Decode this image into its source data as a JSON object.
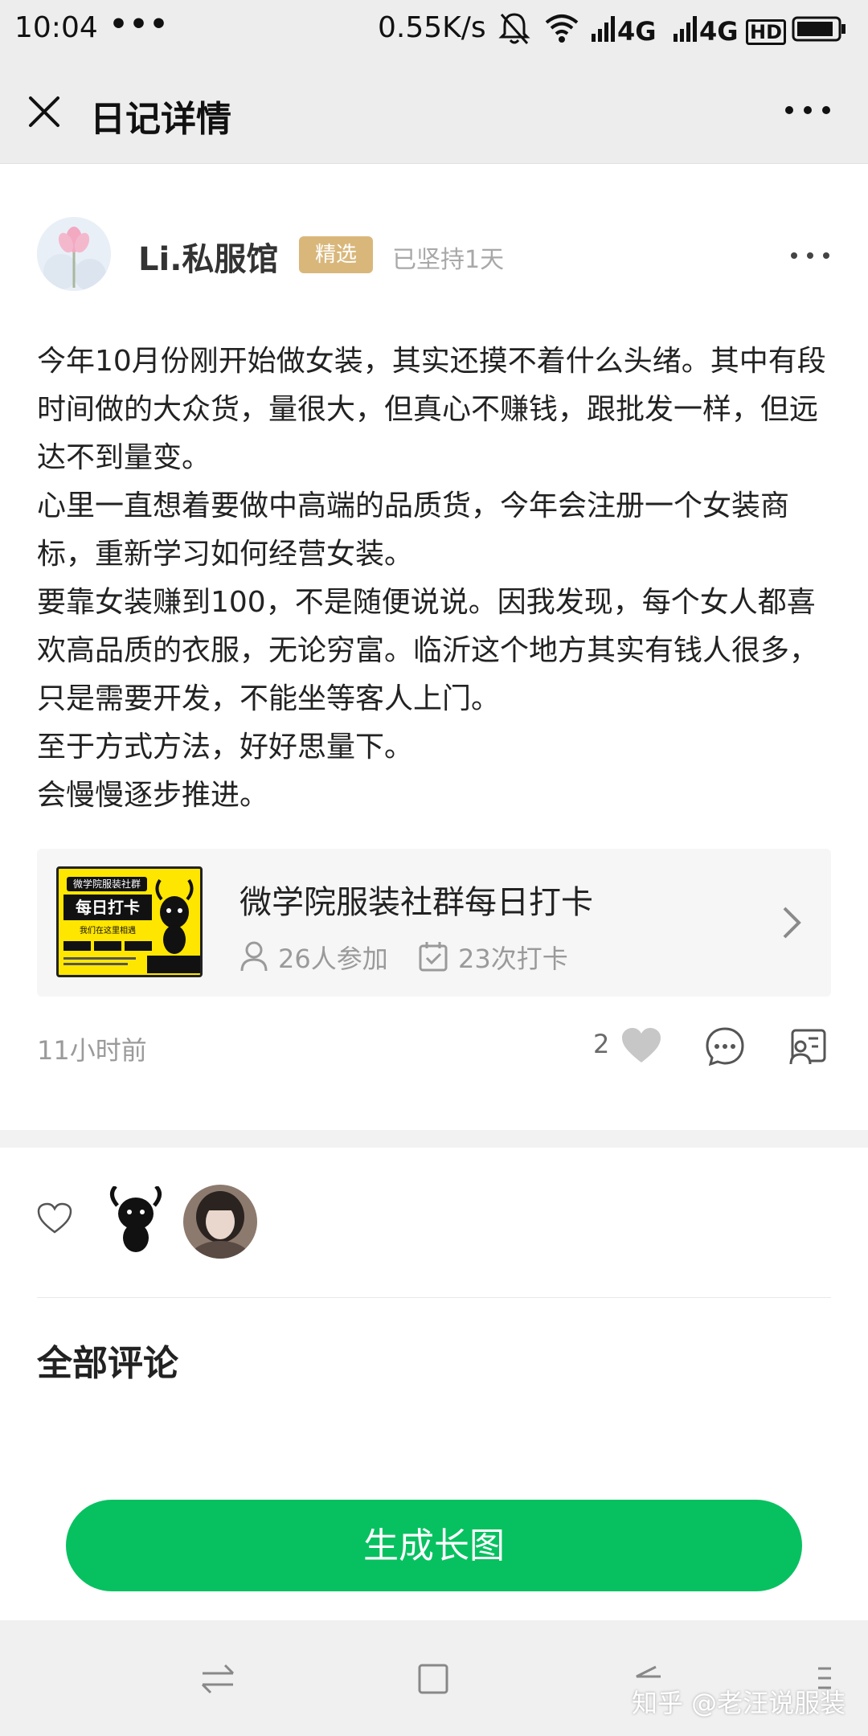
{
  "status_bar": {
    "time": "10:04",
    "dots": "•••",
    "speed": "0.55K/s",
    "net1": "4G",
    "net2": "4G",
    "hd": "HD"
  },
  "header": {
    "title": "日记详情"
  },
  "post": {
    "author": "Li.私服馆",
    "featured_tag": "精选",
    "persist_text": "已坚持1天",
    "paragraphs": [
      "今年10月份刚开始做女装，其实还摸不着什么头绪。其中有段时间做的大众货，量很大，但真心不赚钱，跟批发一样，但远达不到量变。",
      "心里一直想着要做中高端的品质货，今年会注册一个女装商标，重新学习如何经营女装。",
      "要靠女装赚到100，不是随便说说。因我发现，每个女人都喜欢高品质的衣服，无论穷富。临沂这个地方其实有钱人很多，只是需要开发，不能坐等客人上门。",
      "至于方式方法，好好思量下。",
      "会慢慢逐步推进。"
    ]
  },
  "card": {
    "title": "微学院服装社群每日打卡",
    "participants": "26人参加",
    "checkins": "23次打卡",
    "thumb": {
      "top_text": "微学院服装社群",
      "main_text": "每日打卡",
      "sub_text": "我们在这里相遇"
    }
  },
  "actions": {
    "time_ago": "11小时前",
    "like_count": "2"
  },
  "comments": {
    "title": "全部评论"
  },
  "bottom": {
    "generate_label": "生成长图"
  },
  "watermark": "知乎 @老汪说服装",
  "colors": {
    "accent_green": "#07c160",
    "featured_gold": "#d9b77b",
    "thumb_yellow": "#ffe600"
  },
  "icons": [
    "close-icon",
    "more-icon",
    "person-icon",
    "calendar-check-icon",
    "chevron-right-icon",
    "heart-icon",
    "comment-icon",
    "share-icon",
    "back-icon",
    "home-icon",
    "switch-icon"
  ]
}
